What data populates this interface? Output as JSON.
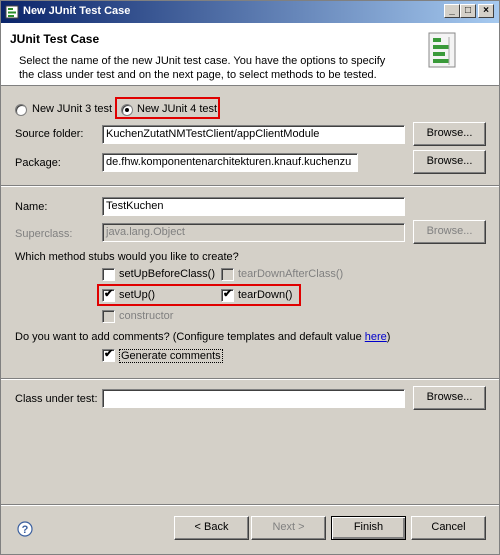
{
  "window": {
    "title": "New JUnit Test Case",
    "controls": [
      "_",
      "□",
      "×"
    ]
  },
  "header": {
    "title": "JUnit Test Case",
    "description": "Select the name of the new JUnit test case. You have the options to specify the class under test and on the next page, to select methods to be tested."
  },
  "version": {
    "junit3_label": "New JUnit 3 test",
    "junit4_label": "New JUnit 4 test",
    "selected": "junit4"
  },
  "form": {
    "source_folder_label": "Source folder:",
    "source_folder_value": "KuchenZutatNMTestClient/appClientModule",
    "package_label": "Package:",
    "package_value": "de.fhw.komponentenarchitekturen.knauf.kuchenzu",
    "name_label": "Name:",
    "name_value": "TestKuchen",
    "superclass_label": "Superclass:",
    "superclass_value": "java.lang.Object",
    "browse_label": "Browse..."
  },
  "stubs": {
    "question": "Which method stubs would you like to create?",
    "setUpBeforeClass": "setUpBeforeClass()",
    "tearDownAfterClass": "tearDownAfterClass()",
    "setUp": "setUp()",
    "tearDown": "tearDown()",
    "constructor": "constructor"
  },
  "comments": {
    "question": "Do you want to add comments? (Configure templates and default value",
    "link": "here",
    "suffix": ")",
    "generate_label": "Generate comments"
  },
  "class_under_test": {
    "label": "Class under test:",
    "value": ""
  },
  "buttons": {
    "back": "< Back",
    "next": "Next >",
    "finish": "Finish",
    "cancel": "Cancel"
  },
  "icons": {
    "title": "junit-icon",
    "header": "junit-wizard-icon",
    "help": "help-icon"
  },
  "colors": {
    "highlight": "#e00000",
    "titlebar": "#0a246a"
  }
}
